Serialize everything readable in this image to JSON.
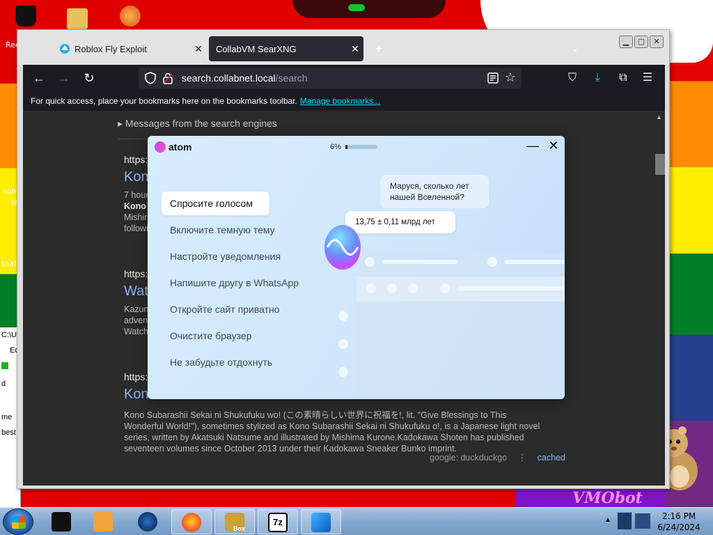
{
  "desktop": {
    "icon_labels": [
      "Rec",
      "som",
      "ra",
      "that"
    ],
    "explorer_fragments": [
      "C:\\Us",
      "Ec",
      "d",
      "E",
      "me",
      "best"
    ],
    "vmobot_text": "VMObot"
  },
  "browser": {
    "tabs": [
      {
        "label": "Roblox Fly Exploit",
        "active": false
      },
      {
        "label": "CollabVM SearXNG",
        "active": true
      }
    ],
    "new_tab": "+",
    "url": {
      "host": "search.collabnet.local",
      "path": "/search"
    },
    "bookmarks_bar": {
      "text": "For quick access, place your bookmarks here on the bookmarks toolbar.",
      "link": "Manage bookmarks..."
    }
  },
  "search_page": {
    "messages_toggle": "▸ Messages from the search engines",
    "results": [
      {
        "url": "https:",
        "title": "Kono",
        "desc_lines": [
          "7 hour",
          "Kono",
          "Mishir",
          "followi"
        ]
      },
      {
        "url": "https:",
        "title": "Watc",
        "desc_lines": [
          "Kazun",
          "adven",
          "Watch"
        ]
      },
      {
        "url": "https:",
        "title": "Kono",
        "desc": "Kono Subarashii Sekai ni Shukufuku wo! (この素晴らしい世界に祝福を!, lit. \"Give Blessings to This Wonderful World!\"), sometimes stylized as Kono Subarashii Sekai ni Shukufuku o!, is a Japanese light novel series, written by Akatsuki Natsume and illustrated by Mishima Kurone.Kadokawa Shoten has published seventeen volumes since October 2013 under their Kadokawa Sneaker Bunko imprint."
      }
    ],
    "result_footer": {
      "engines": "google: duckduckgo",
      "separator": "⋮",
      "cached": "cached"
    }
  },
  "atom_popup": {
    "brand": "atom",
    "progress_label": "6%",
    "progress": 0.06,
    "menu_items": [
      "Спросите голосом",
      "Включите темную тему",
      "Настройте уведомления",
      "Напишите другу в WhatsApp",
      "Откройте сайт приватно",
      "Очистите браузер",
      "Не забудьте отдохнуть"
    ],
    "question_bubble": "Маруся, сколько лет нашей Вселенной?",
    "answer_bubble": "13,75 ± 0,11 млрд лет",
    "minimize": "—",
    "close": "✕"
  },
  "taskbar": {
    "time": "2:16 PM",
    "date": "6/24/2024",
    "box_label": "Box"
  },
  "colors": {
    "accent_link": "#00ddff",
    "result_title": "#8ab4f8",
    "browser_dark": "#1c1b22"
  }
}
